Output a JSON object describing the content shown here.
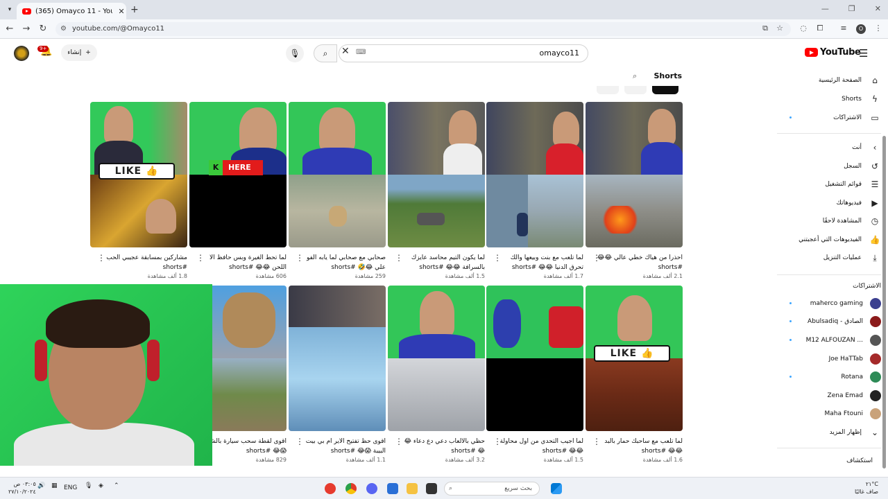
{
  "browser": {
    "tab_title": "(365) Omayco 11 - YouTube",
    "url": "youtube.com/@Omayco11",
    "profile_letter": "O"
  },
  "youtube": {
    "logo_text": "YouTube",
    "search_value": "omayco11",
    "create_label": "إنشاء",
    "notif_count": "9+"
  },
  "shorts_header": {
    "title": "Shorts"
  },
  "videos": [
    {
      "title": "مشاركين بمسابقة عجيبي الحب #shorts",
      "views": "1.8 ألف مشاهدة"
    },
    {
      "title": "لما تحط الغيرة وبس حافظ الا اللحن 😂😂 #shorts",
      "views": "606 مشاهدة"
    },
    {
      "title": "صحابي مع صحابي لما يابه الفو علي 😂🤣 #shorts",
      "views": "259 مشاهدة"
    },
    {
      "title": "لما يكون التيم محاسد عايزك بالسرافة 😂😂 #shorts",
      "views": "1.5 ألف مشاهدة"
    },
    {
      "title": "لما تلعب مع بنت وبيعها والك تحرق الدنيا 😂😂 #shorts",
      "views": "1.7 ألف مشاهدة"
    },
    {
      "title": "احذرا من هياك خطي عالي 😂😂 #shorts",
      "views": "2.1 ألف مشاهدة"
    },
    {
      "title": "اقوى لقطة سحب سيارة بالشابي 😱😂 #shorts",
      "views": "829 مشاهدة"
    },
    {
      "title": "اقوى حظ تفتيح الاير ام بي بيت البيبة 😱😂 #shorts",
      "views": "1.1 ألف مشاهدة"
    },
    {
      "title": "حظي بالالعاب دعي دع دعاء 😂😂 #shorts",
      "views": "3.2 ألف مشاهدة"
    },
    {
      "title": "لما اجيب التحدي من اول محاولة 😂😂 #shorts",
      "views": "1.5 ألف مشاهدة"
    },
    {
      "title": "لما تلعب مع ساحبك حمار بالبد 😂😂 #shorts",
      "views": "1.6 ألف مشاهدة"
    }
  ],
  "overlays": {
    "like_text": "LIKE 👍",
    "here_text": "HERE"
  },
  "sidebar": {
    "main": [
      {
        "label": "الصفحة الرئيسية",
        "icon": "home-icon"
      },
      {
        "label": "Shorts",
        "icon": "shorts-icon"
      },
      {
        "label": "الاشتراكات",
        "icon": "subscriptions-icon"
      }
    ],
    "you_heading": "أنت",
    "you": [
      {
        "label": "السجل",
        "icon": "history-icon"
      },
      {
        "label": "قوائم التشغيل",
        "icon": "playlist-icon"
      },
      {
        "label": "فيديوهاتك",
        "icon": "your-videos-icon"
      },
      {
        "label": "المشاهدة لاحقًا",
        "icon": "watch-later-icon"
      },
      {
        "label": "الفيديوهات التي أعجبتني",
        "icon": "liked-icon"
      },
      {
        "label": "عمليات التنزيل",
        "icon": "download-icon"
      }
    ],
    "subs_heading": "الاشتراكات",
    "subs": [
      {
        "label": "maherco gaming",
        "color": "#3b3f8f"
      },
      {
        "label": "Abulsadiq - الصادق",
        "color": "#8b1a1a"
      },
      {
        "label": "M12 ALFOUZAN ...",
        "color": "#555555"
      },
      {
        "label": "Joe HaTTab",
        "color": "#a52a2a"
      },
      {
        "label": "Rotana",
        "color": "#2e8b57"
      },
      {
        "label": "Zena Emad",
        "color": "#222222"
      },
      {
        "label": "Maha Ftouni",
        "color": "#c9a27a"
      }
    ],
    "show_more": "إظهار المزيد",
    "explore_heading": "استكشاف"
  },
  "taskbar": {
    "search_placeholder": "بحث سريع",
    "language": "ENG",
    "time": "٠٣:٠٥ ص",
    "date": "٢٧/١٠/٢٠٢٤",
    "temp": "٢١°C",
    "weather": "صاف غالبًا"
  }
}
